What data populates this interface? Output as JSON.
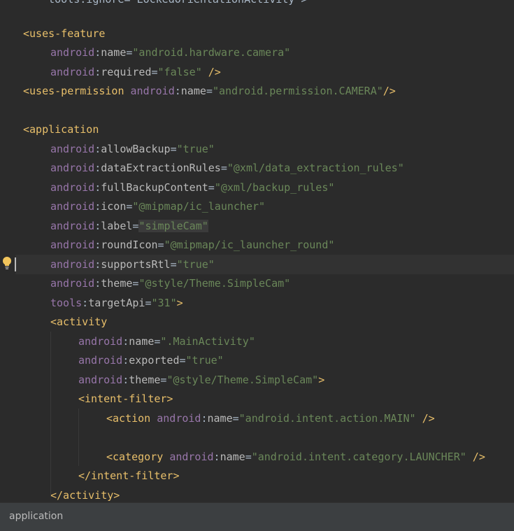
{
  "editor": {
    "partial_top_line": "    tools:ignore=\"LockedOrientationActivity\">",
    "lines": [
      {
        "indent": 1,
        "tokens": [
          [
            "tag",
            "<uses-feature"
          ]
        ]
      },
      {
        "indent": 2,
        "tokens": [
          [
            "ns",
            "android"
          ],
          [
            "punc",
            ":"
          ],
          [
            "attr",
            "name"
          ],
          [
            "punc",
            "="
          ],
          [
            "val",
            "\"android.hardware.camera\""
          ]
        ]
      },
      {
        "indent": 2,
        "tokens": [
          [
            "ns",
            "android"
          ],
          [
            "punc",
            ":"
          ],
          [
            "attr",
            "required"
          ],
          [
            "punc",
            "="
          ],
          [
            "val",
            "\"false\""
          ],
          [
            "punc",
            " "
          ],
          [
            "tag",
            "/>"
          ]
        ]
      },
      {
        "indent": 1,
        "tokens": [
          [
            "tag",
            "<uses-permission"
          ],
          [
            "punc",
            " "
          ],
          [
            "ns",
            "android"
          ],
          [
            "punc",
            ":"
          ],
          [
            "attr",
            "name"
          ],
          [
            "punc",
            "="
          ],
          [
            "val",
            "\"android.permission.CAMERA\""
          ],
          [
            "tag",
            "/>"
          ]
        ]
      },
      {
        "indent": 0,
        "tokens": []
      },
      {
        "indent": 1,
        "tokens": [
          [
            "tag",
            "<application"
          ]
        ]
      },
      {
        "indent": 2,
        "tokens": [
          [
            "ns",
            "android"
          ],
          [
            "punc",
            ":"
          ],
          [
            "attr",
            "allowBackup"
          ],
          [
            "punc",
            "="
          ],
          [
            "val",
            "\"true\""
          ]
        ]
      },
      {
        "indent": 2,
        "tokens": [
          [
            "ns",
            "android"
          ],
          [
            "punc",
            ":"
          ],
          [
            "attr",
            "dataExtractionRules"
          ],
          [
            "punc",
            "="
          ],
          [
            "val",
            "\"@xml/data_extraction_rules\""
          ]
        ]
      },
      {
        "indent": 2,
        "tokens": [
          [
            "ns",
            "android"
          ],
          [
            "punc",
            ":"
          ],
          [
            "attr",
            "fullBackupContent"
          ],
          [
            "punc",
            "="
          ],
          [
            "val",
            "\"@xml/backup_rules\""
          ]
        ]
      },
      {
        "indent": 2,
        "tokens": [
          [
            "ns",
            "android"
          ],
          [
            "punc",
            ":"
          ],
          [
            "attr",
            "icon"
          ],
          [
            "punc",
            "="
          ],
          [
            "val",
            "\"@mipmap/ic_launcher\""
          ]
        ]
      },
      {
        "indent": 2,
        "tokens": [
          [
            "ns",
            "android"
          ],
          [
            "punc",
            ":"
          ],
          [
            "attr",
            "label"
          ],
          [
            "punc",
            "="
          ],
          [
            "valhl",
            "\"simpleCam\""
          ]
        ]
      },
      {
        "indent": 2,
        "tokens": [
          [
            "ns",
            "android"
          ],
          [
            "punc",
            ":"
          ],
          [
            "attr",
            "roundIcon"
          ],
          [
            "punc",
            "="
          ],
          [
            "val",
            "\"@mipmap/ic_launcher_round\""
          ]
        ]
      },
      {
        "indent": 2,
        "tokens": [
          [
            "ns",
            "android"
          ],
          [
            "punc",
            ":"
          ],
          [
            "attr",
            "supportsRtl"
          ],
          [
            "punc",
            "="
          ],
          [
            "val",
            "\"true\""
          ]
        ]
      },
      {
        "indent": 2,
        "tokens": [
          [
            "ns",
            "android"
          ],
          [
            "punc",
            ":"
          ],
          [
            "attr",
            "theme"
          ],
          [
            "punc",
            "="
          ],
          [
            "val",
            "\"@style/Theme.SimpleCam\""
          ]
        ]
      },
      {
        "indent": 2,
        "tokens": [
          [
            "ns",
            "tools"
          ],
          [
            "punc",
            ":"
          ],
          [
            "attr",
            "targetApi"
          ],
          [
            "punc",
            "="
          ],
          [
            "val",
            "\"31\""
          ],
          [
            "tag",
            ">"
          ]
        ]
      },
      {
        "indent": 2,
        "tokens": [
          [
            "tag",
            "<activity"
          ]
        ]
      },
      {
        "indent": 3,
        "tokens": [
          [
            "ns",
            "android"
          ],
          [
            "punc",
            ":"
          ],
          [
            "attr",
            "name"
          ],
          [
            "punc",
            "="
          ],
          [
            "val",
            "\".MainActivity\""
          ]
        ]
      },
      {
        "indent": 3,
        "tokens": [
          [
            "ns",
            "android"
          ],
          [
            "punc",
            ":"
          ],
          [
            "attr",
            "exported"
          ],
          [
            "punc",
            "="
          ],
          [
            "val",
            "\"true\""
          ]
        ]
      },
      {
        "indent": 3,
        "tokens": [
          [
            "ns",
            "android"
          ],
          [
            "punc",
            ":"
          ],
          [
            "attr",
            "theme"
          ],
          [
            "punc",
            "="
          ],
          [
            "val",
            "\"@style/Theme.SimpleCam\""
          ],
          [
            "tag",
            ">"
          ]
        ]
      },
      {
        "indent": 3,
        "tokens": [
          [
            "tag",
            "<intent-filter>"
          ]
        ]
      },
      {
        "indent": 4,
        "tokens": [
          [
            "tag",
            "<action"
          ],
          [
            "punc",
            " "
          ],
          [
            "ns",
            "android"
          ],
          [
            "punc",
            ":"
          ],
          [
            "attr",
            "name"
          ],
          [
            "punc",
            "="
          ],
          [
            "val",
            "\"android.intent.action.MAIN\""
          ],
          [
            "punc",
            " "
          ],
          [
            "tag",
            "/>"
          ]
        ]
      },
      {
        "indent": 0,
        "tokens": []
      },
      {
        "indent": 4,
        "tokens": [
          [
            "tag",
            "<category"
          ],
          [
            "punc",
            " "
          ],
          [
            "ns",
            "android"
          ],
          [
            "punc",
            ":"
          ],
          [
            "attr",
            "name"
          ],
          [
            "punc",
            "="
          ],
          [
            "val",
            "\"android.intent.category.LAUNCHER\""
          ],
          [
            "punc",
            " "
          ],
          [
            "tag",
            "/>"
          ]
        ]
      },
      {
        "indent": 3,
        "tokens": [
          [
            "tag",
            "</intent-filter>"
          ]
        ]
      },
      {
        "indent": 2,
        "tokens": [
          [
            "tag",
            "</activity>"
          ]
        ]
      }
    ]
  },
  "gutter": {
    "intention_icon": "lightbulb-icon"
  },
  "breadcrumb": {
    "label": "application"
  },
  "colors": {
    "background": "#2b2b2b",
    "tag": "#e8bf6a",
    "namespace": "#9876aa",
    "attribute": "#bababa",
    "value": "#6a8759",
    "text": "#a9b7c6"
  }
}
